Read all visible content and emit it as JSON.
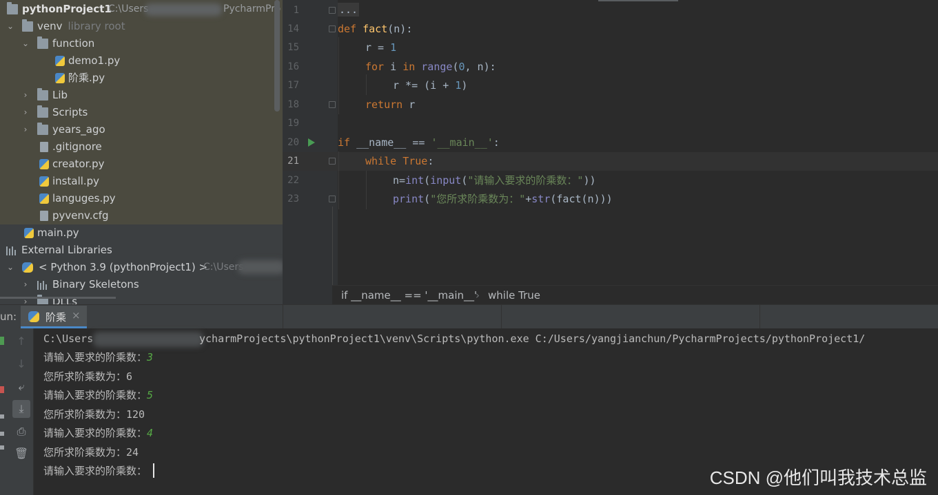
{
  "project_tree": {
    "root": {
      "label": "pythonProject1",
      "path_start": "C:\\Users",
      "path_end": "PycharmPro"
    },
    "venv": {
      "label": "venv",
      "note": "library root"
    },
    "function_folder": "function",
    "files_in_function": [
      "demo1.py",
      "阶乘.py"
    ],
    "venv_folders": [
      "Lib",
      "Scripts",
      "years_ago"
    ],
    "venv_files": [
      ".gitignore",
      "creator.py",
      "install.py",
      "languges.py",
      "pyvenv.cfg"
    ],
    "main_file": "main.py",
    "external_libraries": "External Libraries",
    "python_sdk": {
      "label": "< Python 3.9 (pythonProject1) >",
      "path_start": "C:\\Users"
    },
    "binary_skeletons": "Binary Skeletons",
    "dlls": "DLLs"
  },
  "editor": {
    "line_numbers": [
      "1",
      "14",
      "15",
      "16",
      "17",
      "18",
      "19",
      "20",
      "21",
      "22",
      "23"
    ],
    "folded_text": "...",
    "code": {
      "l14": {
        "kw": "def",
        "fn": "fact",
        "rest": "(n):"
      },
      "l15": {
        "pre": "r = ",
        "num": "1"
      },
      "l16": {
        "kw1": "for",
        "mid1": " i ",
        "kw2": "in",
        "bi": "range",
        "p1": "(",
        "num": "0",
        "p2": ", n):"
      },
      "l17": {
        "pre": "r *= (i + ",
        "num": "1",
        "post": ")"
      },
      "l18": {
        "kw": "return",
        "rest": " r"
      },
      "l20": {
        "kw": "if",
        "mid": " __name__ == ",
        "str": "'__main__'",
        "post": ":"
      },
      "l21": {
        "kw1": "while",
        "kw2": "True",
        "post": ":"
      },
      "l22": {
        "pre": "n=",
        "bi1": "int",
        "p1": "(",
        "bi2": "input",
        "p2": "(",
        "str": "\"请输入要求的阶乘数：\"",
        "post": "))"
      },
      "l23": {
        "bi1": "print",
        "p1": "(",
        "str": "\"您所求阶乘数为：\"",
        "plus": "+",
        "bi2": "str",
        "post": "(fact(n)))"
      }
    },
    "breadcrumb": [
      "if __name__ == '__main__'",
      "while True"
    ]
  },
  "run_panel": {
    "label_prefix": "un:",
    "tab_label": "阶乘",
    "close_glyph": "×",
    "console": {
      "cmd_start": "C:\\Users",
      "cmd_rest": "ycharmProjects\\pythonProject1\\venv\\Scripts\\python.exe C:/Users/yangjianchun/PycharmProjects/pythonProject1/",
      "lines": [
        {
          "prompt": "请输入要求的阶乘数：",
          "input": "3"
        },
        {
          "output": "您所求阶乘数为：6"
        },
        {
          "prompt": "请输入要求的阶乘数：",
          "input": "5"
        },
        {
          "output": "您所求阶乘数为：120"
        },
        {
          "prompt": "请输入要求的阶乘数：",
          "input": "4"
        },
        {
          "output": "您所求阶乘数为：24"
        },
        {
          "prompt": "请输入要求的阶乘数：",
          "input": ""
        }
      ]
    },
    "tools": [
      "arrow-up-icon",
      "arrow-down-icon",
      "soft-wrap-icon",
      "scroll-to-end-icon",
      "print-icon",
      "trash-icon"
    ]
  },
  "watermark": "CSDN @他们叫我技术总监",
  "colors": {
    "keyword": "#cc7832",
    "number": "#6897bb",
    "string": "#6a8759",
    "function": "#ffc66d",
    "builtin": "#8888c6",
    "user_input": "#56a845",
    "run_arrow": "#499c54",
    "tab_underline": "#4a88c7"
  }
}
